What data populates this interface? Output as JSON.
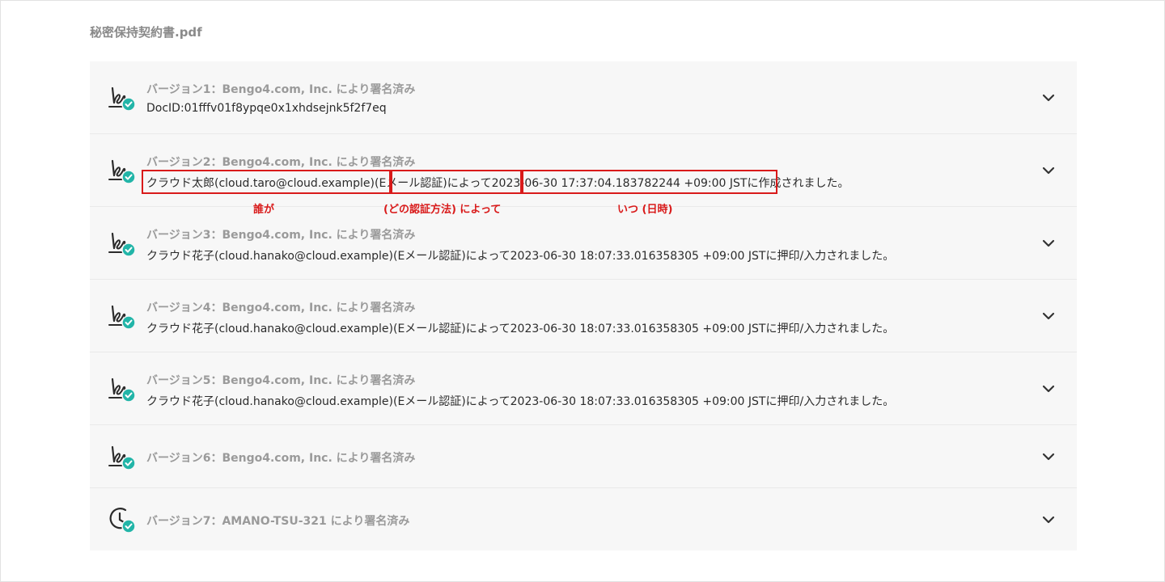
{
  "document": {
    "filename": "秘密保持契約書.pdf"
  },
  "versions": [
    {
      "title": "バージョン1：Bengo4.com, Inc. により署名済み",
      "detail": "DocID:01fffv01f8ypqe0x1xhdsejnk5f2f7eq",
      "icon": "signature-check-icon"
    },
    {
      "title": "バージョン2：Bengo4.com, Inc. により署名済み",
      "detail": "クラウド太郎(cloud.taro@cloud.example)(Eメール認証)によって2023-06-30 17:37:04.183782244 +09:00 JSTに作成されました。",
      "icon": "signature-check-icon"
    },
    {
      "title": "バージョン3：Bengo4.com, Inc. により署名済み",
      "detail": "クラウド花子(cloud.hanako@cloud.example)(Eメール認証)によって2023-06-30 18:07:33.016358305 +09:00 JSTに押印/入力されました。",
      "icon": "signature-check-icon"
    },
    {
      "title": "バージョン4：Bengo4.com, Inc. により署名済み",
      "detail": "クラウド花子(cloud.hanako@cloud.example)(Eメール認証)によって2023-06-30 18:07:33.016358305 +09:00 JSTに押印/入力されました。",
      "icon": "signature-check-icon"
    },
    {
      "title": "バージョン5：Bengo4.com, Inc. により署名済み",
      "detail": "クラウド花子(cloud.hanako@cloud.example)(Eメール認証)によって2023-06-30 18:07:33.016358305 +09:00 JSTに押印/入力されました。",
      "icon": "signature-check-icon"
    },
    {
      "title": "バージョン6：Bengo4.com, Inc. により署名済み",
      "icon": "signature-check-icon"
    },
    {
      "title": "バージョン7：AMANO-TSU-321 により署名済み",
      "icon": "timestamp-check-icon"
    }
  ],
  "annotations": {
    "who": "誰が",
    "method": "(どの認証方法) によって",
    "when": "いつ (日時)"
  },
  "colors": {
    "annotation_red": "#d91a1a",
    "check_teal": "#22b5a8",
    "panel_bg": "#f7f7f7",
    "title_gray": "#9a9a9a"
  }
}
